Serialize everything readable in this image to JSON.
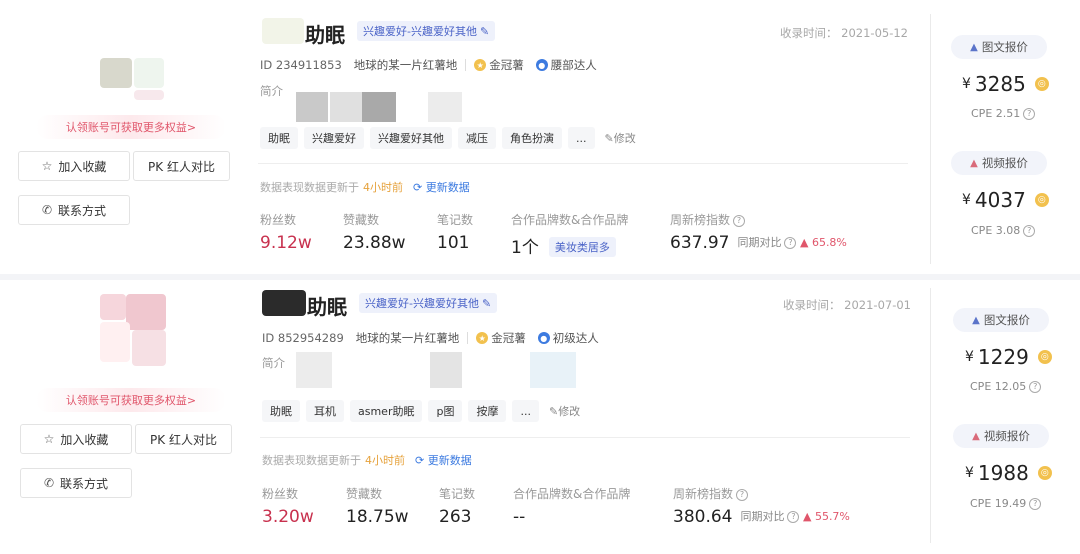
{
  "cards": [
    {
      "name": "助眠",
      "tagline": "兴趣爱好-兴趣爱好其他",
      "record_label": "收录时间：",
      "record_date": "2021-05-12",
      "id_label": "ID",
      "id": "234911853",
      "location": "地球的某一片红薯地",
      "rank": "金冠薯",
      "level": "腰部达人",
      "intro_label": "简介",
      "claim": "认领账号可获取更多权益>",
      "fav_label": "加入收藏",
      "pk_label": "PK 红人对比",
      "contact_label": "联系方式",
      "tags": [
        "助眠",
        "兴趣爱好",
        "兴趣爱好其他",
        "减压",
        "角色扮演",
        "..."
      ],
      "edit_label": "修改",
      "updated_prefix": "数据表现数据更新于",
      "updated_time": "4小时前",
      "refresh_label": "更新数据",
      "stats": {
        "fans_label": "粉丝数",
        "fans": "9.12w",
        "likes_label": "赞藏数",
        "likes": "23.88w",
        "notes_label": "笔记数",
        "notes": "101",
        "brands_label": "合作品牌数&合作品牌",
        "brands": "1个",
        "brand_tag": "美妆类居多",
        "index_label": "周新榜指数",
        "index": "637.97",
        "compare_label": "同期对比",
        "compare_value": "▲ 65.8%"
      },
      "image_price_label": "图文报价",
      "image_price": "3285",
      "image_cpe": "CPE 2.51",
      "video_price_label": "视频报价",
      "video_price": "4037",
      "video_cpe": "CPE 3.08"
    },
    {
      "name": "助眠",
      "tagline": "兴趣爱好-兴趣爱好其他",
      "record_label": "收录时间：",
      "record_date": "2021-07-01",
      "id_label": "ID",
      "id": "852954289",
      "location": "地球的某一片红薯地",
      "rank": "金冠薯",
      "level": "初级达人",
      "intro_label": "简介",
      "claim": "认领账号可获取更多权益>",
      "fav_label": "加入收藏",
      "pk_label": "PK 红人对比",
      "contact_label": "联系方式",
      "tags": [
        "助眠",
        "耳机",
        "asmer助眠",
        "p图",
        "按摩",
        "..."
      ],
      "edit_label": "修改",
      "updated_prefix": "数据表现数据更新于",
      "updated_time": "4小时前",
      "refresh_label": "更新数据",
      "stats": {
        "fans_label": "粉丝数",
        "fans": "3.20w",
        "likes_label": "赞藏数",
        "likes": "18.75w",
        "notes_label": "笔记数",
        "notes": "263",
        "brands_label": "合作品牌数&合作品牌",
        "brands": "--",
        "brand_tag": "",
        "index_label": "周新榜指数",
        "index": "380.64",
        "compare_label": "同期对比",
        "compare_value": "▲ 55.7%"
      },
      "image_price_label": "图文报价",
      "image_price": "1229",
      "image_cpe": "CPE 12.05",
      "video_price_label": "视频报价",
      "video_price": "1988",
      "video_cpe": "CPE 19.49"
    }
  ],
  "colors": {
    "accent_blue": "#4a63c7",
    "pink_value": "#c8314e",
    "gold": "#f2c14e"
  }
}
